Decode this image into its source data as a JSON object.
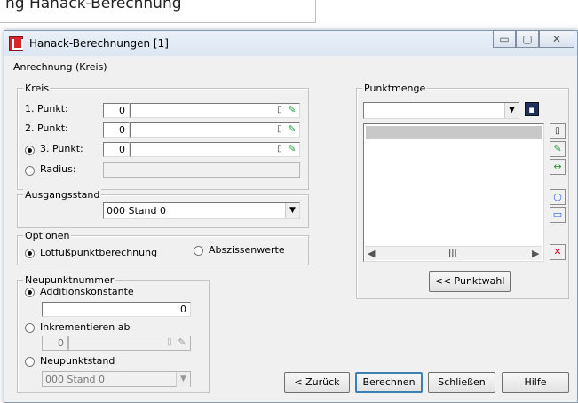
{
  "background_window": {
    "title": "ng Hanack-Berechnung"
  },
  "window": {
    "title": "Hanack-Berechnungen [1]",
    "controls": {
      "minimize": "▭",
      "maximize": "▢",
      "close": "✕"
    }
  },
  "menu": {
    "label": "Anrechnung (Kreis)"
  },
  "kreis": {
    "legend": "Kreis",
    "p1": {
      "label": "1. Punkt:",
      "num": "0"
    },
    "p2": {
      "label": "2. Punkt:",
      "num": "0"
    },
    "p3": {
      "label": "3. Punkt:",
      "num": "0"
    },
    "radius": {
      "label": "Radius:"
    }
  },
  "ausgangsstand": {
    "legend": "Ausgangsstand",
    "value": "000    Stand 0"
  },
  "optionen": {
    "legend": "Optionen",
    "lotfuss": "Lotfußpunktberechnung",
    "abszissen": "Abszissenwerte"
  },
  "neupunkt": {
    "legend": "Neupunktnummer",
    "addition_label": "Additionskonstante",
    "addition_value": "0",
    "inkrement_label": "Inkrementieren ab",
    "inkrement_value": "0",
    "stand_label": "Neupunktstand",
    "stand_value": "000   Stand 0"
  },
  "punktmenge": {
    "legend": "Punktmenge",
    "scroll_thumb": "III",
    "punktwahl_button": "<< Punktwahl"
  },
  "footer": {
    "back": "< Zurück",
    "compute": "Berechnen",
    "close": "Schließen",
    "help": "Hilfe"
  },
  "colors": {
    "accent": "#3c7fb1",
    "delete": "#c8102e",
    "icon_green": "#1a9c3a",
    "icon_blue": "#2d5fd6"
  }
}
